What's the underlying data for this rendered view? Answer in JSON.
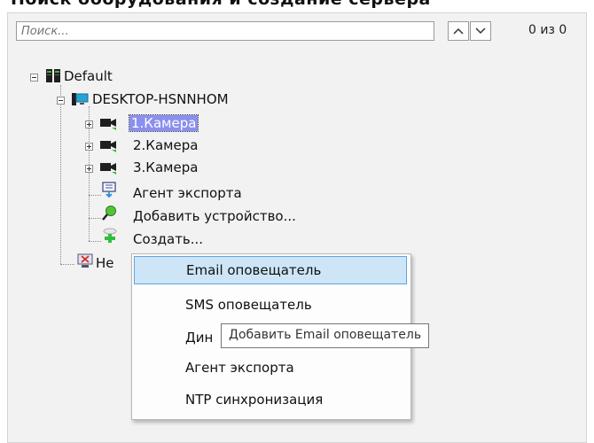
{
  "top_text": "Поиск оборудования и создание сервера",
  "search": {
    "placeholder": "Поиск..."
  },
  "nav": {
    "prev_icon": "chevron-up-icon",
    "next_icon": "chevron-down-icon",
    "counter": "0 из 0"
  },
  "tree": {
    "root": "Default",
    "server": "DESKTOP-HSNNHOM",
    "cameras": [
      "1.Камера",
      "2.Камера",
      "3.Камера"
    ],
    "export_agent": "Агент экспорта",
    "add_device": "Добавить устройство...",
    "create": "Создать...",
    "partial_item": "Не"
  },
  "context_menu": {
    "items": [
      "Email оповещатель",
      "SMS оповещатель",
      "Дин",
      "Агент экспорта",
      "NTP синхронизация"
    ],
    "active_index": 0
  },
  "tooltip": "Добавить Email оповещатель",
  "colors": {
    "selection": "#8a8ff0",
    "menu_highlight": "#cde5f7",
    "panel": "#f2f2f2"
  }
}
